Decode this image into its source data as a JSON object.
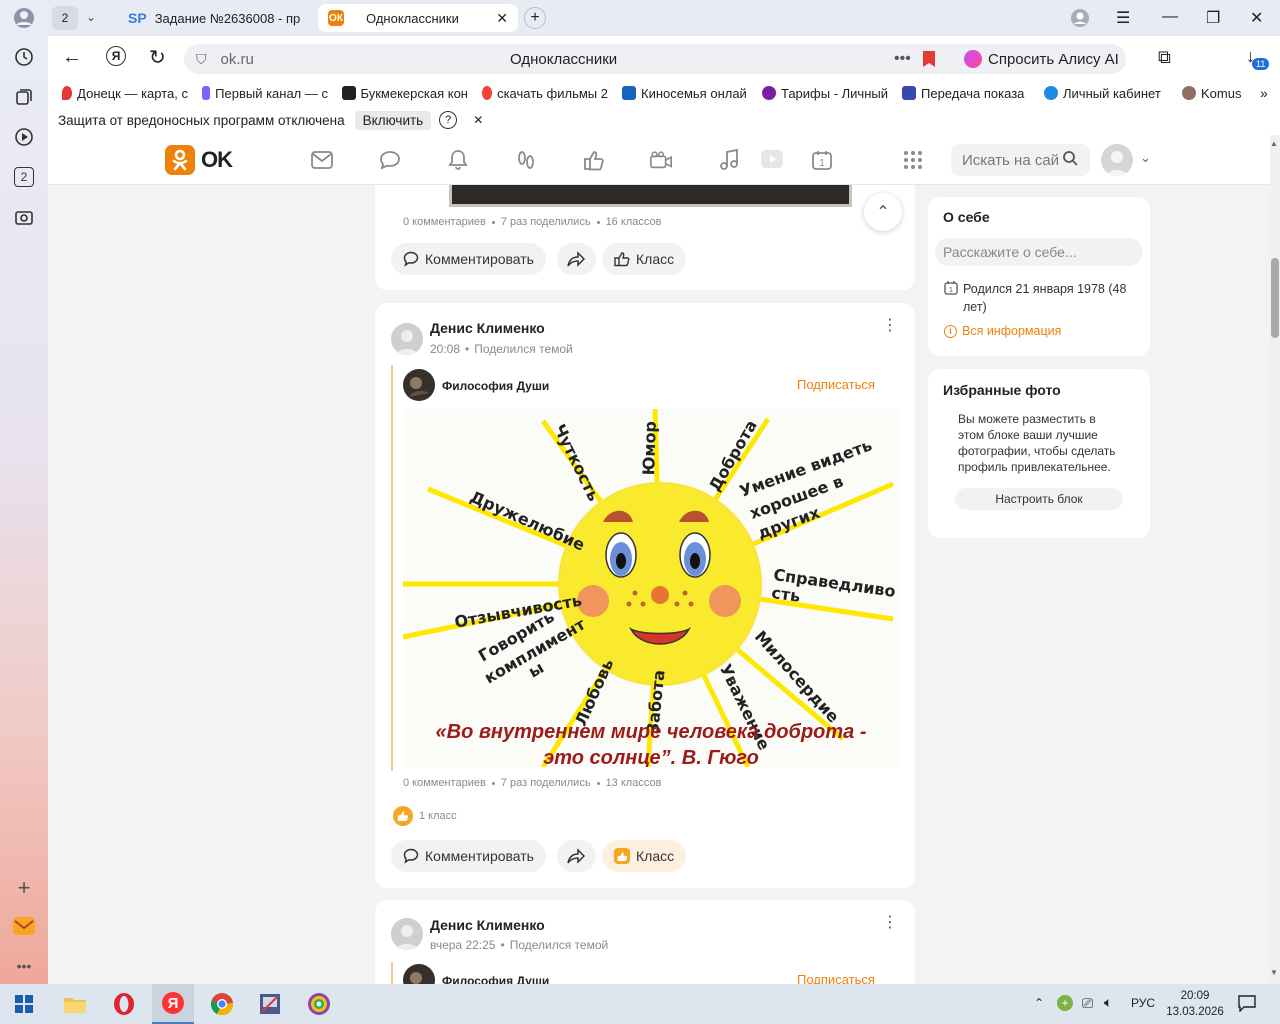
{
  "browser": {
    "tab_count": "2",
    "tabs": [
      {
        "label": "Задание №2636008 - про",
        "icon": "SP"
      },
      {
        "label": "Одноклассники",
        "icon": "ok"
      }
    ],
    "url": "ok.ru",
    "page_title": "Одноклассники",
    "alice_label": "Спросить Алису AI",
    "downloads_badge": "11",
    "bookmarks": [
      {
        "label": "Донецк — карта, с",
        "color": "#e53935"
      },
      {
        "label": "Первый канал — с",
        "color": "#7b61ff"
      },
      {
        "label": "Букмекерская кон",
        "color": "#222222"
      },
      {
        "label": "скачать фильмы 2",
        "color": "#f44336"
      },
      {
        "label": "Киносемья онлай",
        "color": "#1565c0"
      },
      {
        "label": "Тарифы - Личный",
        "color": "#7b1fa2"
      },
      {
        "label": "Передача показа",
        "color": "#3949ab"
      },
      {
        "label": "Личный кабинет",
        "color": "#1e88e5"
      },
      {
        "label": "Komus",
        "color": "#8d6e63"
      }
    ],
    "protection_text": "Защита от вредоносных программ отключена",
    "protection_button": "Включить",
    "protection_help": "?",
    "sidebar_badge": "2"
  },
  "ok": {
    "logo_text": "OK",
    "search_placeholder": "Искать на сай",
    "nav_icons": [
      "mail-icon",
      "chat-icon",
      "bell-icon",
      "guests-icon",
      "like-icon",
      "video-icon",
      "music-icon",
      "video-play-icon",
      "calendar-icon",
      "apps-icon"
    ]
  },
  "post0": {
    "stats": [
      "0 комментариев",
      "7 раз поделились",
      "16 классов"
    ],
    "comment_label": "Комментировать",
    "like_label": "Класс"
  },
  "post1": {
    "author": "Денис Клименко",
    "time": "20:08",
    "action": "Поделился темой",
    "group_name": "Философия Души",
    "subscribe_label": "Подписаться",
    "image": {
      "rays": [
        "Чуткость",
        "Юмор",
        "Доброта",
        "Умение видеть хорошее в других",
        "Справедливость",
        "Милосердие",
        "Уважение",
        "Забота",
        "Любовь",
        "Говорить комплименты",
        "Отзывчивость",
        "Дружелюбие"
      ],
      "ray_lines": {
        "Чуткость": [
          "Чуткость"
        ],
        "Юмор": [
          "Юмор"
        ],
        "Доброта": [
          "Доброта"
        ],
        "Умение": [
          "Умение видеть",
          "хорошее в",
          "других"
        ],
        "Справедливость": [
          "Справедливо",
          "сть"
        ],
        "Милосердие": [
          "Милосердие"
        ],
        "Уважение": [
          "Уважение"
        ],
        "Забота": [
          "Забота"
        ],
        "Любовь": [
          "Любовь"
        ],
        "Говорить": [
          "Говорить",
          "комплимент",
          "ы"
        ],
        "Отзывчивость": [
          "Отзывчивость"
        ],
        "Дружелюбие": [
          "Дружелюбие"
        ]
      },
      "quote_line1": "«Во внутреннем мире человека доброта -",
      "quote_line2": "это солнце”.  В. Гюго"
    },
    "stats": [
      "0 комментариев",
      "7 раз поделились",
      "13 классов"
    ],
    "likes_summary": "1 класс",
    "comment_label": "Комментировать",
    "like_label": "Класс"
  },
  "post2": {
    "author": "Денис Клименко",
    "time": "вчера 22:25",
    "action": "Поделился темой",
    "group_name": "Философия Души",
    "subscribe_label": "Подписаться"
  },
  "about": {
    "title": "О себе",
    "placeholder": "Расскажите о себе...",
    "birthday_line1": "Родился 21 января 1978 (48",
    "birthday_line2": "лет)",
    "all_info": "Вся информация"
  },
  "photos": {
    "title": "Избранные фото",
    "desc_line1": "Вы можете разместить в",
    "desc_line2": "этом блоке ваши лучшие",
    "desc_line3": "фотографии, чтобы сделать",
    "desc_line4": "профиль привлекательнее.",
    "button": "Настроить блок"
  },
  "taskbar": {
    "lang": "РУС",
    "time": "20:09",
    "date": "13.03.2026"
  },
  "colors": {
    "accent": "#ee8208",
    "quote": "#9b1b1b"
  }
}
